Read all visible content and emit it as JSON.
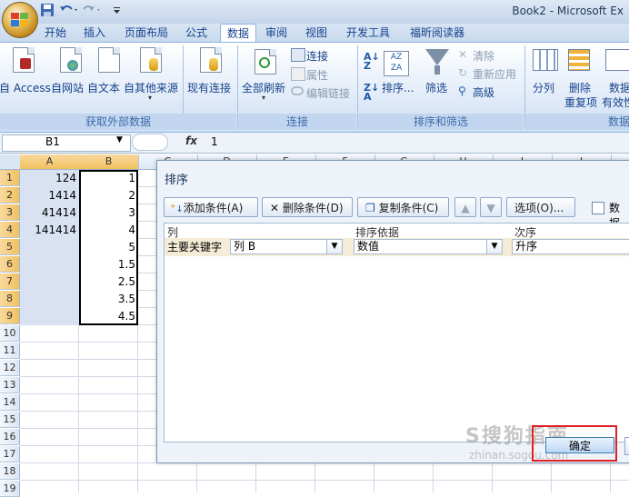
{
  "window": {
    "title": "Book2 - Microsoft Ex"
  },
  "tabs": [
    "开始",
    "插入",
    "页面布局",
    "公式",
    "数据",
    "审阅",
    "视图",
    "开发工具",
    "福昕阅读器"
  ],
  "active_tab": "数据",
  "ribbon": {
    "external": {
      "label": "获取外部数据",
      "access": "自 Access",
      "web": "自网站",
      "text": "自文本",
      "other": "自其他来源",
      "existing": "现有连接"
    },
    "connections": {
      "label": "连接",
      "refresh_all": "全部刷新",
      "connections": "连接",
      "properties": "属性",
      "edit_links": "编辑链接"
    },
    "sort_filter": {
      "label": "排序和筛选",
      "sort": "排序...",
      "filter": "筛选",
      "clear": "清除",
      "reapply": "重新应用",
      "advanced": "高级"
    },
    "data_tools": {
      "label": "数据",
      "split": "分列",
      "remove_dup_1": "删除",
      "remove_dup_2": "重复项",
      "validation_1": "数据",
      "validation_2": "有效性"
    }
  },
  "formula_bar": {
    "name_box": "B1",
    "fx": "fx",
    "value": "1"
  },
  "columns": [
    "A",
    "B",
    "C",
    "D",
    "E",
    "F",
    "G",
    "H",
    "I",
    "J"
  ],
  "rows": [
    "1",
    "2",
    "3",
    "4",
    "5",
    "6",
    "7",
    "8",
    "9",
    "10",
    "11",
    "12",
    "13",
    "14",
    "15",
    "16",
    "17",
    "18",
    "19"
  ],
  "cells": {
    "A": [
      "124",
      "1414",
      "41414",
      "141414",
      "",
      "",
      "",
      "",
      ""
    ],
    "B": [
      "1",
      "2",
      "3",
      "4",
      "5",
      "1.5",
      "2.5",
      "3.5",
      "4.5"
    ]
  },
  "dialog": {
    "title": "排序",
    "buttons": {
      "add": "添加条件(A)",
      "delete": "删除条件(D)",
      "copy": "复制条件(C)",
      "options": "选项(O)...",
      "header_checkbox": "数据"
    },
    "headers": {
      "column": "列",
      "sort_on": "排序依据",
      "order": "次序"
    },
    "row": {
      "label": "主要关键字",
      "column": "列 B",
      "sort_on": "数值",
      "order": "升序"
    },
    "ok": "确定"
  },
  "watermark": {
    "main": "S搜狗指南",
    "sub": "zhinan.sogou.com"
  },
  "colors": {
    "accent": "#15428b",
    "ribbon_blue": "#c2d6ef",
    "selection": "#f1c15f",
    "highlight": "#e02020"
  }
}
